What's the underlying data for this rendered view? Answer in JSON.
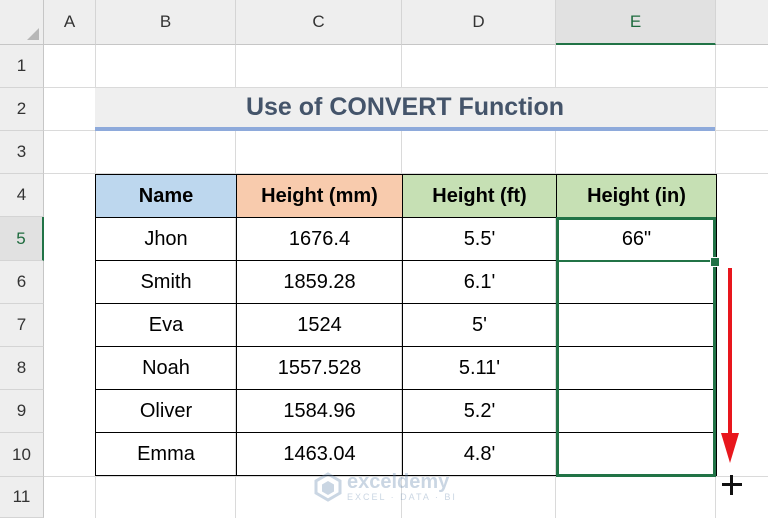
{
  "columns": [
    "A",
    "B",
    "C",
    "D",
    "E"
  ],
  "selected_column": "E",
  "rows": [
    "1",
    "2",
    "3",
    "4",
    "5",
    "6",
    "7",
    "8",
    "9",
    "10",
    "11"
  ],
  "selected_row": "5",
  "title": "Use of CONVERT Function",
  "table": {
    "headers": [
      "Name",
      "Height (mm)",
      "Height (ft)",
      "Height (in)"
    ],
    "rows": [
      [
        "Jhon",
        "1676.4",
        "5.5'",
        "66\""
      ],
      [
        "Smith",
        "1859.28",
        "6.1'",
        ""
      ],
      [
        "Eva",
        "1524",
        "5'",
        ""
      ],
      [
        "Noah",
        "1557.528",
        "5.11'",
        ""
      ],
      [
        "Oliver",
        "1584.96",
        "5.2'",
        ""
      ],
      [
        "Emma",
        "1463.04",
        "4.8'",
        ""
      ]
    ]
  },
  "watermark": {
    "name": "exceldemy",
    "tagline": "EXCEL · DATA · BI"
  },
  "colors": {
    "header_name": "#bdd7ee",
    "header_mm": "#f8cbad",
    "header_ft": "#c6e0b4",
    "header_in": "#c6e0b4",
    "selection": "#217346",
    "arrow": "#e8171d",
    "title_text": "#44546a"
  }
}
